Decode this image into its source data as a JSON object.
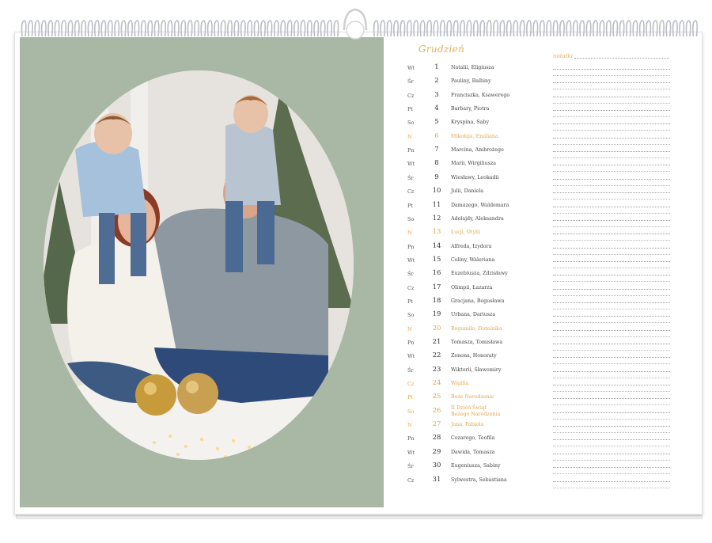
{
  "calendar": {
    "month": "Grudzień",
    "notes_label": "notatki",
    "colors": {
      "accent": "#e3a64a",
      "photo_bg": "#a9b8a5",
      "text": "#444444"
    },
    "days": [
      {
        "dow": "Wt",
        "day": "1",
        "names": "Natalii, Eligiusza",
        "holiday": false
      },
      {
        "dow": "Śr",
        "day": "2",
        "names": "Pauliny, Balbiny",
        "holiday": false
      },
      {
        "dow": "Cz",
        "day": "3",
        "names": "Franciszka, Ksawerego",
        "holiday": false
      },
      {
        "dow": "Pt",
        "day": "4",
        "names": "Barbary, Piotra",
        "holiday": false
      },
      {
        "dow": "So",
        "day": "5",
        "names": "Kryspina, Saby",
        "holiday": false
      },
      {
        "dow": "N",
        "day": "6",
        "names": "Mikołaja, Emiliana",
        "holiday": true
      },
      {
        "dow": "Pn",
        "day": "7",
        "names": "Marcina, Ambrożego",
        "holiday": false
      },
      {
        "dow": "Wt",
        "day": "8",
        "names": "Marii, Wirgiliusza",
        "holiday": false
      },
      {
        "dow": "Śr",
        "day": "9",
        "names": "Wiesławy, Leokadii",
        "holiday": false
      },
      {
        "dow": "Cz",
        "day": "10",
        "names": "Julii, Daniela",
        "holiday": false
      },
      {
        "dow": "Pt",
        "day": "11",
        "names": "Damazego, Waldemara",
        "holiday": false
      },
      {
        "dow": "So",
        "day": "12",
        "names": "Adelajdy, Aleksandra",
        "holiday": false
      },
      {
        "dow": "N",
        "day": "13",
        "names": "Łucji, Otylii",
        "holiday": true
      },
      {
        "dow": "Pn",
        "day": "14",
        "names": "Alfreda, Izydora",
        "holiday": false
      },
      {
        "dow": "Wt",
        "day": "15",
        "names": "Celiny, Waleriana",
        "holiday": false
      },
      {
        "dow": "Śr",
        "day": "16",
        "names": "Euzebiusza, Zdzisławy",
        "holiday": false
      },
      {
        "dow": "Cz",
        "day": "17",
        "names": "Olimpii, Łazarza",
        "holiday": false
      },
      {
        "dow": "Pt",
        "day": "18",
        "names": "Gracjana, Bogusława",
        "holiday": false
      },
      {
        "dow": "So",
        "day": "19",
        "names": "Urbana, Dariusza",
        "holiday": false
      },
      {
        "dow": "N",
        "day": "20",
        "names": "Bogumiła, Dominika",
        "holiday": true
      },
      {
        "dow": "Pn",
        "day": "21",
        "names": "Tomasza, Tomisława",
        "holiday": false
      },
      {
        "dow": "Wt",
        "day": "22",
        "names": "Zenona, Honoraty",
        "holiday": false
      },
      {
        "dow": "Śr",
        "day": "23",
        "names": "Wiktorii, Sławomiry",
        "holiday": false
      },
      {
        "dow": "Cz",
        "day": "24",
        "names": "Wigilia",
        "holiday": true
      },
      {
        "dow": "Pt",
        "day": "25",
        "names": "Boże Narodzenie",
        "holiday": true
      },
      {
        "dow": "So",
        "day": "26",
        "names": "II Dzień Świąt Bożego Narodzenia",
        "holiday": true
      },
      {
        "dow": "N",
        "day": "27",
        "names": "Jana, Fabiola",
        "holiday": true
      },
      {
        "dow": "Pn",
        "day": "28",
        "names": "Cezarego, Teofila",
        "holiday": false
      },
      {
        "dow": "Wt",
        "day": "29",
        "names": "Dawida, Tomasza",
        "holiday": false
      },
      {
        "dow": "Śr",
        "day": "30",
        "names": "Eugeniusza, Sabiny",
        "holiday": false
      },
      {
        "dow": "Cz",
        "day": "31",
        "names": "Sylwestra, Sebastiana",
        "holiday": false
      }
    ]
  }
}
